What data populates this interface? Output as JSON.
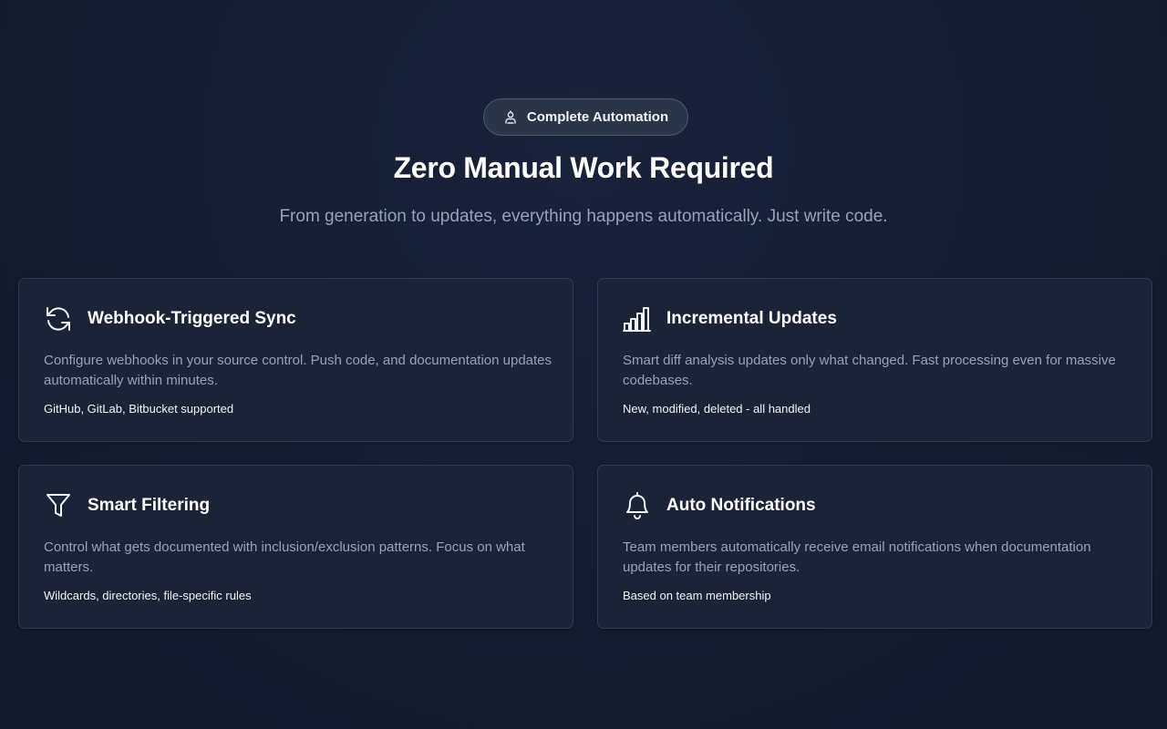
{
  "badge": {
    "label": "Complete Automation",
    "icon": "robot-icon"
  },
  "title": "Zero Manual Work Required",
  "subtitle": "From generation to updates, everything happens automatically. Just write code.",
  "cards": [
    {
      "title": "Webhook-Triggered Sync",
      "icon": "refresh-icon",
      "description": "Configure webhooks in your source control. Push code, and documentation updates automatically within minutes.",
      "note": "GitHub, GitLab, Bitbucket supported"
    },
    {
      "title": "Incremental Updates",
      "icon": "bar-chart-icon",
      "description": "Smart diff analysis updates only what changed. Fast processing even for massive codebases.",
      "note": "New, modified, deleted - all handled"
    },
    {
      "title": "Smart Filtering",
      "icon": "filter-icon",
      "description": "Control what gets documented with inclusion/exclusion patterns. Focus on what matters.",
      "note": "Wildcards, directories, file-specific rules"
    },
    {
      "title": "Auto Notifications",
      "icon": "bell-icon",
      "description": "Team members automatically receive email notifications when documentation updates for their repositories.",
      "note": "Based on team membership"
    }
  ],
  "colors": {
    "background": "#141c2f",
    "card": "#1b2436",
    "card_border": "#2d3a4f",
    "muted_text": "#94a3b8"
  }
}
